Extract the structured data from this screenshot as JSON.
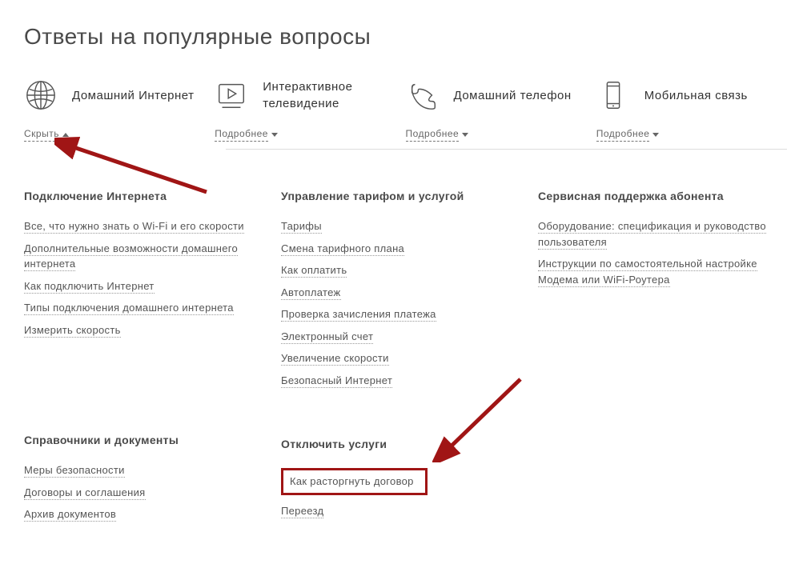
{
  "title": "Ответы на популярные вопросы",
  "categories": [
    {
      "name": "Домашний Интернет",
      "toggle": "Скрыть",
      "icon": "globe",
      "expanded": true
    },
    {
      "name": "Интерактивное телевидение",
      "toggle": "Подробнее",
      "icon": "play-tv",
      "expanded": false
    },
    {
      "name": "Домашний телефон",
      "toggle": "Подробнее",
      "icon": "phone",
      "expanded": false
    },
    {
      "name": "Мобильная связь",
      "toggle": "Подробнее",
      "icon": "smartphone",
      "expanded": false
    }
  ],
  "columns": [
    {
      "sections": [
        {
          "heading": "Подключение Интернета",
          "links": [
            "Все, что нужно знать о Wi-Fi и его скорости",
            "Дополнительные возможности домашнего интернета",
            "Как подключить Интернет",
            "Типы подключения домашнего интернета",
            "Измерить скорость"
          ]
        },
        {
          "heading": "Справочники и документы",
          "links": [
            "Меры безопасности",
            "Договоры и соглашения",
            "Архив документов"
          ]
        }
      ]
    },
    {
      "sections": [
        {
          "heading": "Управление тарифом и услугой",
          "links": [
            "Тарифы",
            "Смена тарифного плана",
            "Как оплатить",
            "Автоплатеж",
            "Проверка зачисления платежа",
            "Электронный счет",
            "Увеличение скорости",
            "Безопасный Интернет"
          ]
        },
        {
          "heading": "Отключить услуги",
          "links": [
            "Как расторгнуть договор",
            "Переезд"
          ],
          "highlight": 0
        }
      ]
    },
    {
      "sections": [
        {
          "heading": "Сервисная поддержка абонента",
          "links": [
            "Оборудование: спецификация и руководство пользователя",
            "Инструкции по самостоятельной настройке Модема или WiFi-Роутера"
          ]
        }
      ]
    }
  ]
}
